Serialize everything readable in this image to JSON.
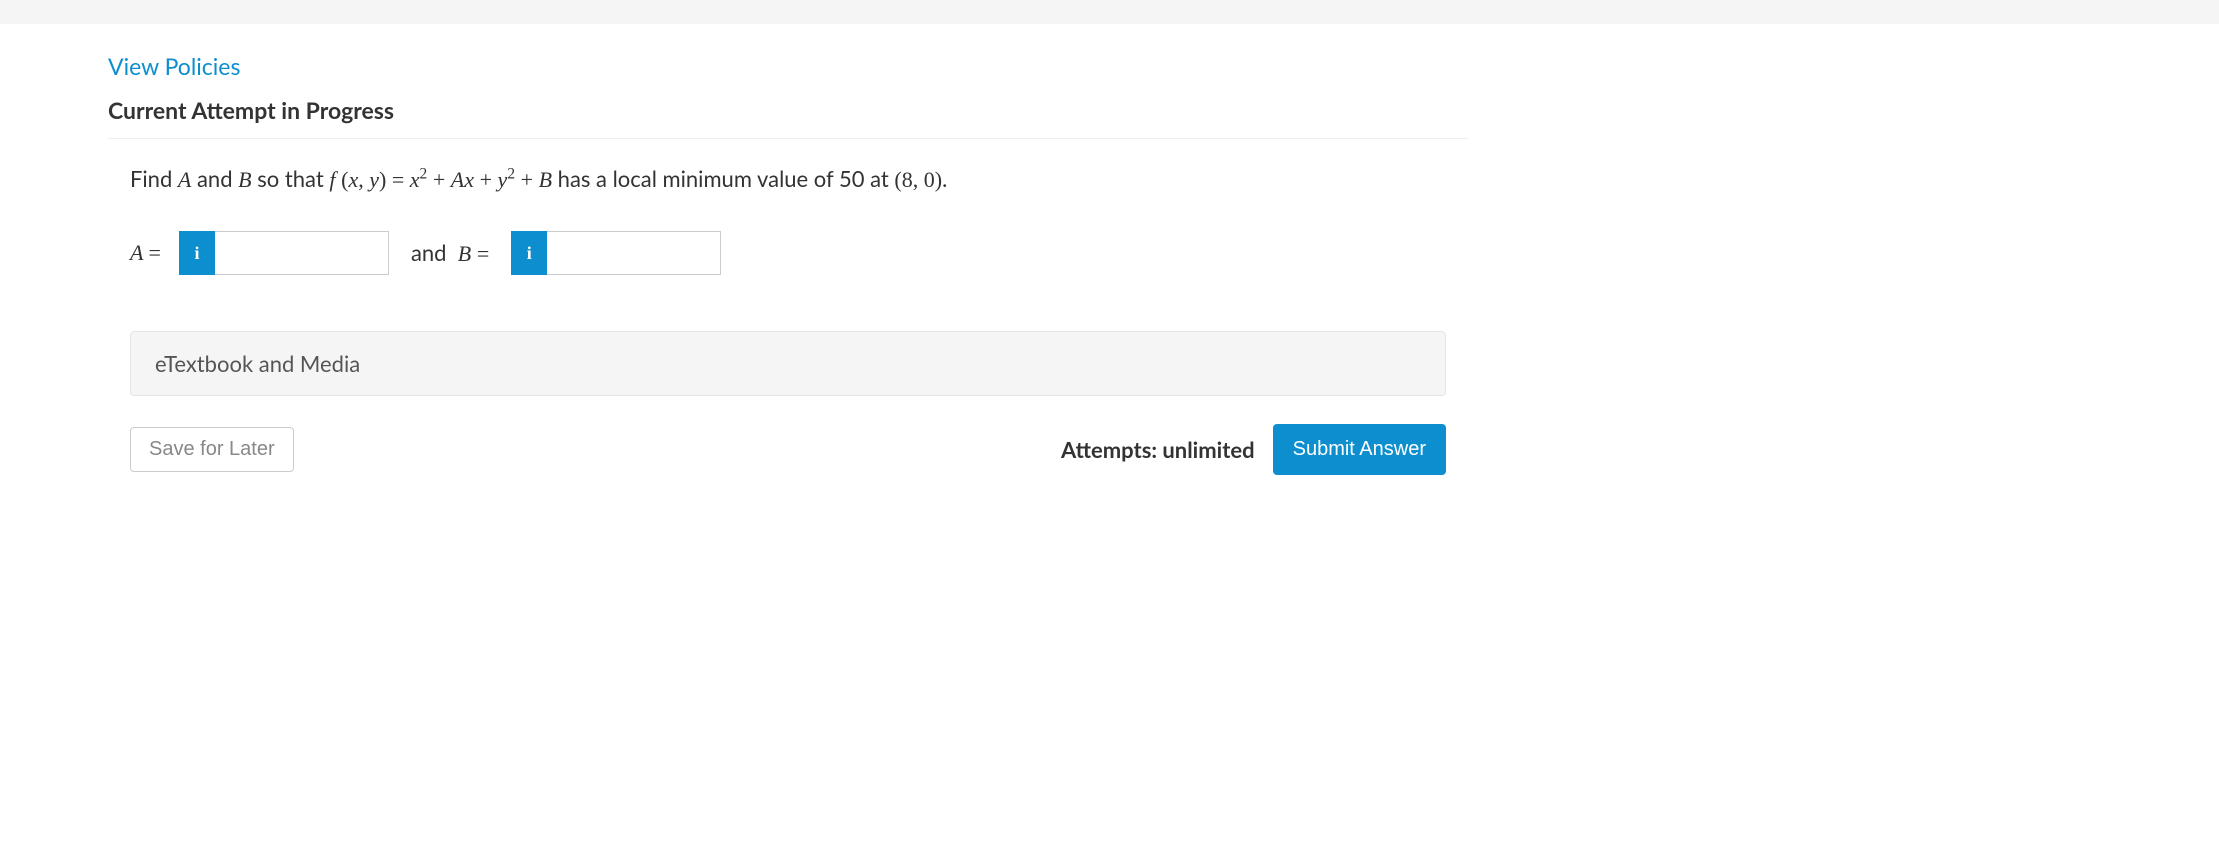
{
  "links": {
    "view_policies": "View Policies"
  },
  "headings": {
    "attempt": "Current Attempt in Progress"
  },
  "question": {
    "prefix": "Find ",
    "A": "A",
    "and1": " and ",
    "B": "B",
    "so_that": " so that ",
    "f": "f",
    "lpar": " (",
    "x": "x",
    "comma": ", ",
    "y": "y",
    "rpar_eq": ") = ",
    "x2": "x",
    "sup2a": "2",
    "plus1": " + ",
    "Ax_A": "A",
    "Ax_x": "x",
    "plus2": " + ",
    "y2": "y",
    "sup2b": "2",
    "plus3": " + ",
    "B2": "B",
    "tail1": " has a local minimum value of 50 at ",
    "pt_l": "(",
    "pt_a": "8",
    "pt_c": ", ",
    "pt_b": "0",
    "pt_r": ")",
    "period": "."
  },
  "inputs": {
    "A_label": "A = ",
    "A_value": "",
    "and": "and",
    "B_label": "B = ",
    "B_value": "",
    "info_glyph": "i"
  },
  "resources": {
    "etextbook": "eTextbook and Media"
  },
  "actions": {
    "save": "Save for Later",
    "attempts": "Attempts: unlimited",
    "submit": "Submit Answer"
  }
}
